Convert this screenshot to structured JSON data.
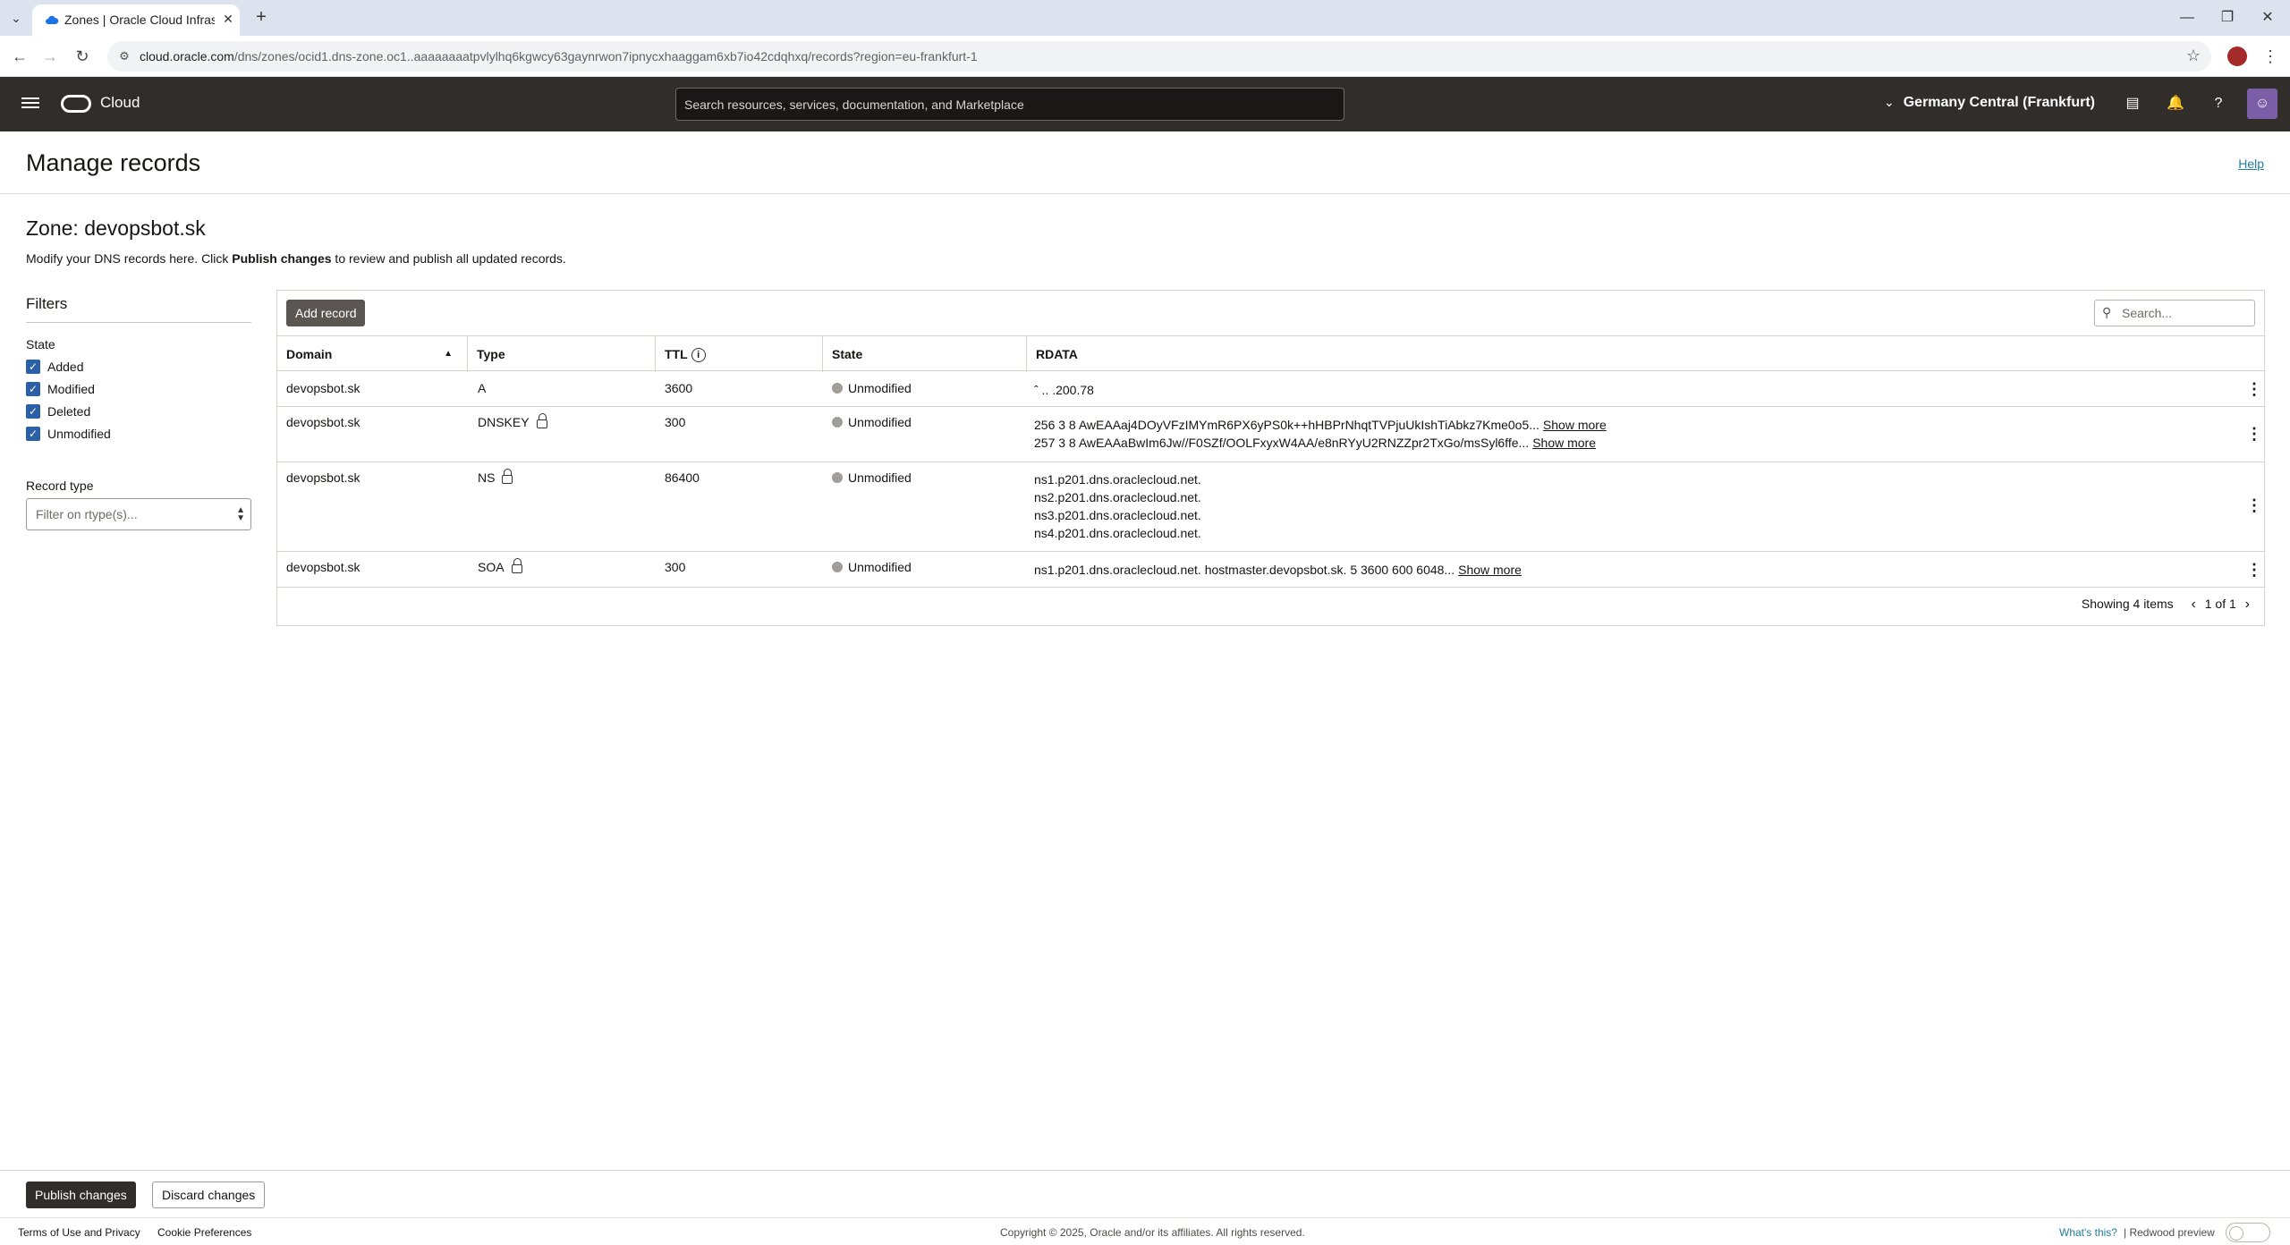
{
  "browser": {
    "tab_title": "Zones | Oracle Cloud Infrastructu",
    "url_host": "cloud.oracle.com",
    "url_path": "/dns/zones/ocid1.dns-zone.oc1..aaaaaaaatpvlylhq6kgwcy63gaynrwon7ipnycxhaaggam6xb7io42cdqhxq/records?region=eu-frankfurt-1"
  },
  "header": {
    "brand": "Cloud",
    "search_placeholder": "Search resources, services, documentation, and Marketplace",
    "region": "Germany Central (Frankfurt)"
  },
  "page": {
    "title": "Manage records",
    "help": "Help",
    "zone_title": "Zone: devopsbot.sk",
    "desc_pre": "Modify your DNS records here. Click ",
    "desc_bold": "Publish changes",
    "desc_post": " to review and publish all updated records."
  },
  "filters": {
    "title": "Filters",
    "state_label": "State",
    "states": [
      "Added",
      "Modified",
      "Deleted",
      "Unmodified"
    ],
    "record_type_label": "Record type",
    "record_type_placeholder": "Filter on rtype(s)..."
  },
  "table": {
    "add_record": "Add record",
    "search_placeholder": "Search...",
    "columns": [
      "Domain",
      "Type",
      "TTL",
      "State",
      "RDATA"
    ],
    "rows": [
      {
        "domain": "devopsbot.sk",
        "type": "A",
        "ttl": "3600",
        "state": "Unmodified",
        "rdata": [
          "ˆ ..  .200.78"
        ]
      },
      {
        "domain": "devopsbot.sk",
        "type": "DNSKEY",
        "ttl": "300",
        "state": "Unmodified",
        "rdata": [
          "256 3 8 AwEAAaj4DOyVFzIMYmR6PX6yPS0k++hHBPrNhqtTVPjuUkIshTiAbkz7Kme0o5...",
          "257 3 8 AwEAAaBwIm6Jw//F0SZf/OOLFxyxW4AA/e8nRYyU2RNZZpr2TxGo/msSyl6ffe..."
        ]
      },
      {
        "domain": "devopsbot.sk",
        "type": "NS",
        "ttl": "86400",
        "state": "Unmodified",
        "rdata": [
          "ns1.p201.dns.oraclecloud.net.",
          "ns2.p201.dns.oraclecloud.net.",
          "ns3.p201.dns.oraclecloud.net.",
          "ns4.p201.dns.oraclecloud.net."
        ]
      },
      {
        "domain": "devopsbot.sk",
        "type": "SOA",
        "ttl": "300",
        "state": "Unmodified",
        "rdata": [
          "ns1.p201.dns.oraclecloud.net. hostmaster.devopsbot.sk. 5 3600 600 6048..."
        ]
      }
    ],
    "show_more": "Show more",
    "showing": "Showing 4 items",
    "page": "1 of 1"
  },
  "actions": {
    "publish": "Publish changes",
    "discard": "Discard changes"
  },
  "footer": {
    "terms": "Terms of Use and Privacy",
    "cookies": "Cookie Preferences",
    "copyright": "Copyright © 2025, Oracle and/or its affiliates. All rights reserved.",
    "whats_this": "What's this?",
    "redwood": "| Redwood preview"
  },
  "colors": {
    "header_bg": "#312d2a",
    "link": "#227e9e",
    "checkbox": "#2b5fa8"
  }
}
